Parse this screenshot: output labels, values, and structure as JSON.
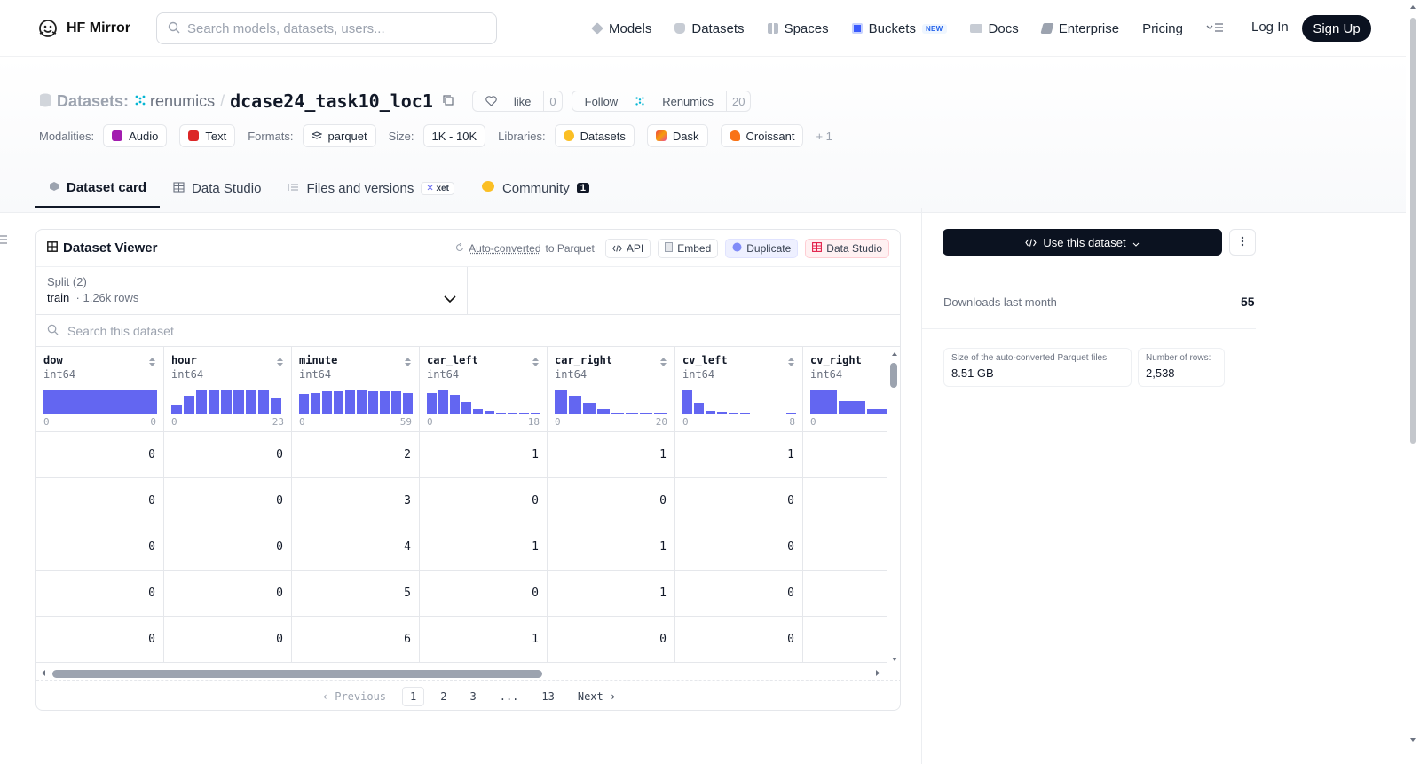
{
  "header": {
    "brand": "HF Mirror",
    "search_placeholder": "Search models, datasets, users...",
    "nav": [
      {
        "label": "Models",
        "icon": "cube-icon"
      },
      {
        "label": "Datasets",
        "icon": "database-icon"
      },
      {
        "label": "Spaces",
        "icon": "grid-icon"
      },
      {
        "label": "Buckets",
        "icon": "bucket-icon",
        "badge": "NEW"
      },
      {
        "label": "Docs",
        "icon": "book-icon"
      },
      {
        "label": "Enterprise",
        "icon": "enterprise-icon"
      },
      {
        "label": "Pricing"
      }
    ],
    "login": "Log In",
    "signup": "Sign Up"
  },
  "dataset": {
    "label": "Datasets:",
    "org": "renumics",
    "sep": "/",
    "name": "dcase24_task10_loc1",
    "like_label": "like",
    "like_count": "0",
    "follow_label": "Follow",
    "follow_org": "Renumics",
    "follow_count": "20",
    "modalities_label": "Modalities:",
    "modalities": [
      "Audio",
      "Text"
    ],
    "formats_label": "Formats:",
    "formats": [
      "parquet"
    ],
    "size_label": "Size:",
    "size": "1K - 10K",
    "libraries_label": "Libraries:",
    "libraries": [
      "Datasets",
      "Dask",
      "Croissant"
    ],
    "more_libraries": "+ 1"
  },
  "tabs": [
    {
      "label": "Dataset card"
    },
    {
      "label": "Data Studio"
    },
    {
      "label": "Files and versions",
      "badge": "xet"
    },
    {
      "label": "Community",
      "badge": "1"
    }
  ],
  "viewer": {
    "title": "Dataset Viewer",
    "auto_converted_link": "Auto-converted",
    "auto_converted_suffix": "to Parquet",
    "actions": [
      "API",
      "Embed",
      "Duplicate",
      "Data Studio"
    ],
    "split_label": "Split (2)",
    "split_value": "train",
    "split_rows": "1.26k rows",
    "search_placeholder": "Search this dataset",
    "columns": [
      {
        "name": "dow",
        "type": "int64",
        "min": "0",
        "max": "0",
        "hist": [
          1
        ]
      },
      {
        "name": "hour",
        "type": "int64",
        "min": "0",
        "max": "23",
        "hist": [
          0.4,
          0.75,
          1,
          1,
          1,
          1,
          1,
          1,
          0.7
        ]
      },
      {
        "name": "minute",
        "type": "int64",
        "min": "0",
        "max": "59",
        "hist": [
          0.85,
          0.9,
          0.95,
          0.95,
          1,
          1,
          0.95,
          0.95,
          0.95,
          0.9
        ]
      },
      {
        "name": "car_left",
        "type": "int64",
        "min": "0",
        "max": "18",
        "hist": [
          0.9,
          1,
          0.8,
          0.5,
          0.2,
          0.1,
          0.05,
          0.05,
          0.05,
          0.05
        ]
      },
      {
        "name": "car_right",
        "type": "int64",
        "min": "0",
        "max": "20",
        "hist": [
          1,
          0.75,
          0.45,
          0.2,
          0.05,
          0.04,
          0.04,
          0.04
        ]
      },
      {
        "name": "cv_left",
        "type": "int64",
        "min": "0",
        "max": "8",
        "hist": [
          1,
          0.45,
          0.12,
          0.06,
          0.05,
          0.04,
          0,
          0,
          0,
          0.04
        ]
      },
      {
        "name": "cv_right",
        "type": "int64",
        "min": "0",
        "max": "",
        "hist": [
          1,
          0.55,
          0.2,
          0.08
        ]
      }
    ],
    "rows": [
      [
        "0",
        "0",
        "2",
        "1",
        "1",
        "1",
        ""
      ],
      [
        "0",
        "0",
        "3",
        "0",
        "0",
        "0",
        ""
      ],
      [
        "0",
        "0",
        "4",
        "1",
        "1",
        "0",
        ""
      ],
      [
        "0",
        "0",
        "5",
        "0",
        "1",
        "0",
        ""
      ],
      [
        "0",
        "0",
        "6",
        "1",
        "0",
        "0",
        ""
      ]
    ],
    "pager": {
      "previous": "Previous",
      "pages": [
        "1",
        "2",
        "3",
        "...",
        "13"
      ],
      "next": "Next",
      "current": "1"
    }
  },
  "sidebar": {
    "use_button": "Use this dataset",
    "downloads_label": "Downloads last month",
    "downloads_value": "55",
    "stats": [
      {
        "label": "Size of the auto-converted Parquet files:",
        "value": "8.51 GB"
      },
      {
        "label": "Number of rows:",
        "value": "2,538"
      }
    ]
  },
  "colors": {
    "accent": "#6366f1",
    "dark": "#0b1220",
    "audio": "#a21caf",
    "text": "#dc2626"
  }
}
